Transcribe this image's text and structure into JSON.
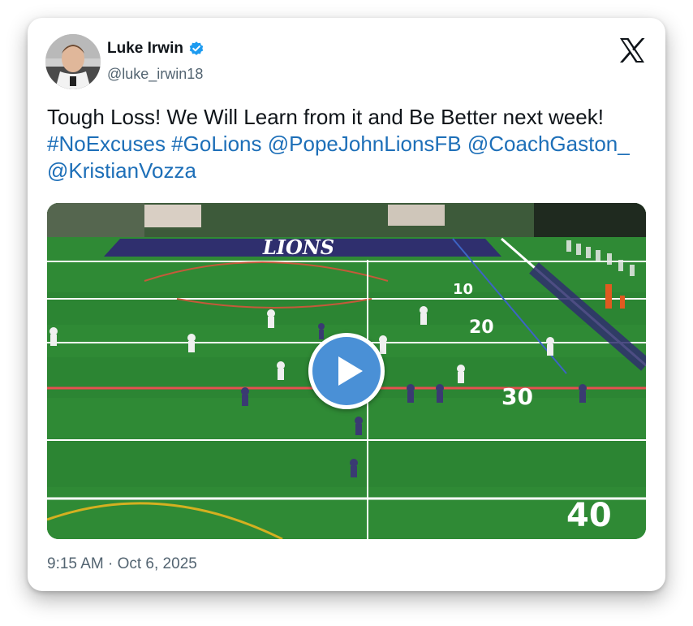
{
  "author": {
    "name": "Luke Irwin",
    "handle": "@luke_irwin18",
    "verified": true,
    "avatar_icon": "player-portrait-icon"
  },
  "platform_logo": "x-logo-icon",
  "tweet": {
    "text_plain": "Tough Loss! We Will Learn from it and Be Better next week!",
    "links": [
      "#NoExcuses",
      "#GoLions",
      "@PopeJohnLionsFB",
      "@CoachGaston_",
      "@KristianVozza"
    ]
  },
  "media": {
    "type": "video",
    "field_banner": "LIONS",
    "yard_numbers": [
      "10",
      "20",
      "30",
      "40"
    ],
    "play_icon": "play-icon"
  },
  "timestamp": "9:15 AM · Oct 6, 2025",
  "colors": {
    "link": "#1d6fb8",
    "verified": "#1d9bf0",
    "play_button": "#4a90d6",
    "field": "#2f7d2f",
    "endzone": "#2f2f6e"
  }
}
